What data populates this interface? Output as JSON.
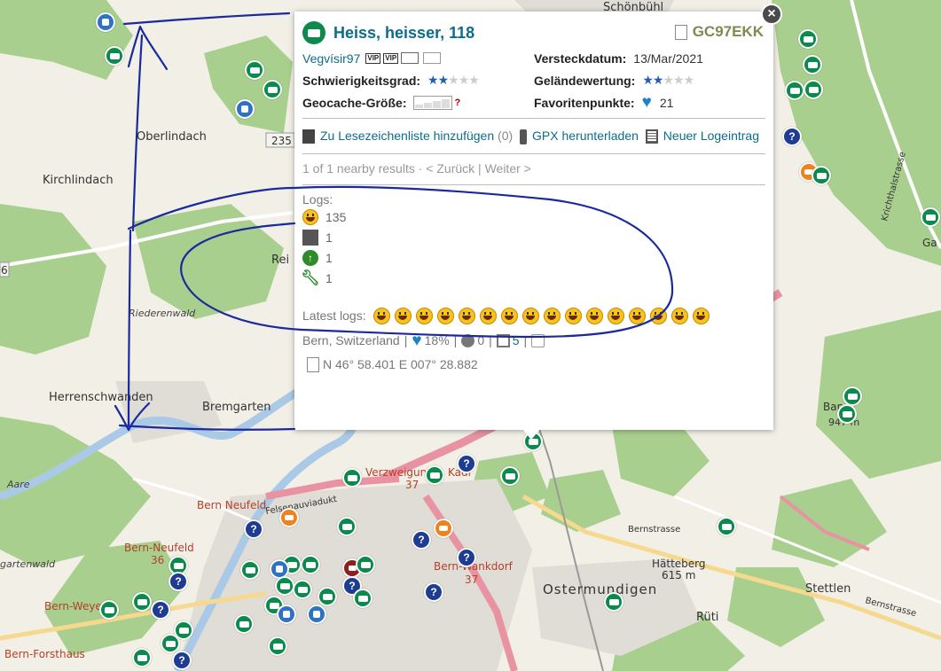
{
  "colors": {
    "accent_link": "#0b6d8a",
    "title": "#0b5e7a",
    "gc_code": "#7f8a4e",
    "traditional_marker": "#0c8a4c",
    "mystery_marker": "#1e3d92",
    "annotation_ink": "#1a2a9e",
    "favorite_heart": "#1d82c6"
  },
  "map": {
    "place_labels": {
      "schoenbuehl": "Schönbühl",
      "oberlindach": "Oberlindach",
      "kirchlindach": "Kirchlindach",
      "riederenwald": "Riederenwald",
      "herrenschwanden": "Herrenschwanden",
      "bremgarten": "Bremgarten",
      "aare": "Aare",
      "gartenwald": "gartenwald",
      "bern_neufeld_top": "Bern Neufeld",
      "bern_neufeld_bottom": "Bern-Neufeld",
      "bern_neufeld_number": "36",
      "bern_weyermann": "Bern-Weyerm",
      "bern_forsthaus": "Bern-Forsthaus",
      "verzweigung": "Verzweigung",
      "verzweigung_number": "37",
      "bern_wankdorf": "Bern-Wankdorf",
      "bern_wankdorf_number": "37",
      "ostermundigen": "Ostermundigen",
      "rueti": "Rüti",
      "haetteberg": "Hätteberg",
      "haetteberg_height": "615 m",
      "stettlen": "Stettlen",
      "bernstrasse_1": "Bernstrasse",
      "bernstrasse_2": "Bernstrasse",
      "felsenauviadukt": "Felsenauviadukt",
      "road_235": "235",
      "road_6": "6",
      "partial_rei": "Rei",
      "partial_ga": "Ga",
      "partial_bantiger": "Ban",
      "partial_height": "947 m",
      "lindenthalstrasse": "Krichthalstrasse",
      "kadn": "Kadr"
    }
  },
  "popup": {
    "title": "Heiss, heisser, 118",
    "gc_code": "GC97EKK",
    "owner": "Vegvísir97",
    "vip_badge_1": "VIP",
    "vip_badge_2": "VIP",
    "hidden_label": "Versteckdatum:",
    "hidden_value": "13/Mar/2021",
    "difficulty_label": "Schwierigkeitsgrad:",
    "difficulty": 1.5,
    "terrain_label": "Geländewertung:",
    "terrain": 1.5,
    "size_label": "Geocache-Größe:",
    "size_value": "?",
    "favorites_label": "Favoritenpunkte:",
    "favorites_value": "21",
    "action_bookmark": "Zu Lesezeichenliste hinzufügen",
    "action_bookmark_count": "(0)",
    "action_gpx": "GPX herunterladen",
    "action_log": "Neuer Logeintrag",
    "nearby_text": "1 of 1 nearby results ·",
    "nav_back": "< Zurück",
    "nav_sep": "|",
    "nav_next": "Weiter >",
    "logs_label": "Logs:",
    "log_counts": [
      {
        "type": "found",
        "count": "135"
      },
      {
        "type": "write-note",
        "count": "1"
      },
      {
        "type": "publish",
        "count": "1"
      },
      {
        "type": "maintenance",
        "count": "1"
      }
    ],
    "latest_logs_label": "Latest logs:",
    "latest_logs_count": 16,
    "location": "Bern, Switzerland",
    "sep": "|",
    "fav_percent": "18%",
    "trackables": "0",
    "gallery_count": "5",
    "coordinates": "N 46° 58.401 E 007° 28.882"
  }
}
